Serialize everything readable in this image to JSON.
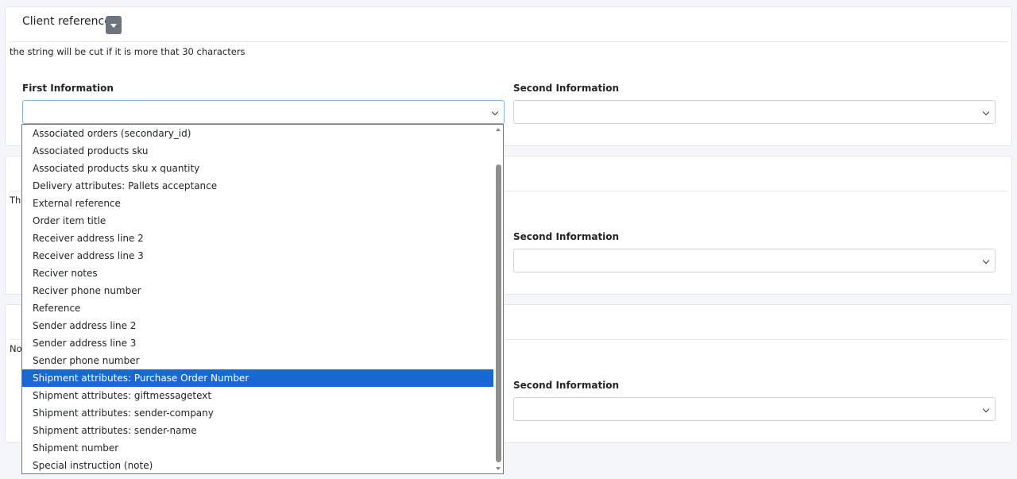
{
  "card1": {
    "title": "Client reference",
    "hint": "the string will be cut if it is more that 30 characters",
    "first_label": "First Information",
    "second_label": "Second Information"
  },
  "card2": {
    "hint_visible": "The",
    "second_label": "Second Information"
  },
  "card3": {
    "hint_visible": "Not",
    "second_label": "Second Information"
  },
  "dropdown": {
    "selected_index": 14,
    "options": [
      "Associated orders (secondary_id)",
      "Associated products sku",
      "Associated products sku x quantity",
      "Delivery attributes: Pallets acceptance",
      "External reference",
      "Order item title",
      "Receiver address line 2",
      "Receiver address line 3",
      "Reciver notes",
      "Reciver phone number",
      "Reference",
      "Sender address line 2",
      "Sender address line 3",
      "Sender phone number",
      "Shipment attributes: Purchase Order Number",
      "Shipment attributes: giftmessagetext",
      "Shipment attributes: sender-company",
      "Shipment attributes: sender-name",
      "Shipment number",
      "Special instruction (note)"
    ]
  },
  "colors": {
    "selected_option_bg": "#1967d2",
    "dropdown_toggle_bg": "#6c757d",
    "focused_border": "#80b3df"
  }
}
